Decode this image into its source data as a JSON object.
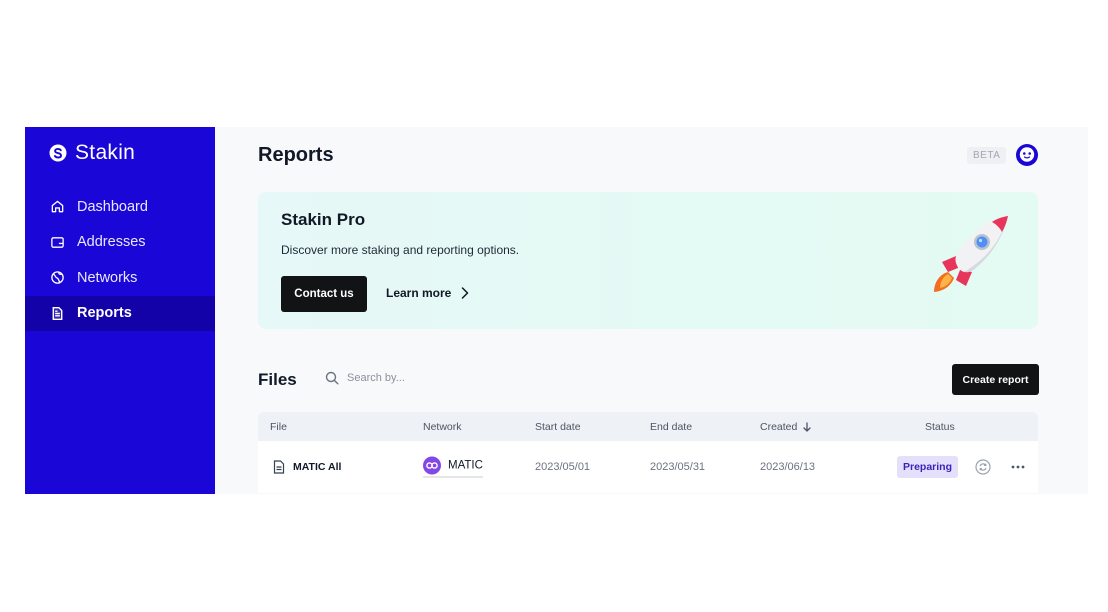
{
  "brand": {
    "name": "Stakin",
    "logo_icon": "stakin-logo-icon"
  },
  "sidebar": {
    "items": [
      {
        "label": "Dashboard",
        "icon": "home-icon",
        "active": false
      },
      {
        "label": "Addresses",
        "icon": "wallet-icon",
        "active": false
      },
      {
        "label": "Networks",
        "icon": "globe-icon",
        "active": false
      },
      {
        "label": "Reports",
        "icon": "document-icon",
        "active": true
      }
    ]
  },
  "header": {
    "title": "Reports",
    "beta_label": "BETA",
    "avatar_icon": "avatar-icon"
  },
  "promo": {
    "title": "Stakin Pro",
    "description": "Discover more staking and reporting options.",
    "contact_label": "Contact us",
    "learn_more_label": "Learn more",
    "illustration": "rocket-icon"
  },
  "files": {
    "title": "Files",
    "search_placeholder": "Search by...",
    "create_label": "Create report",
    "columns": {
      "file": "File",
      "network": "Network",
      "start_date": "Start date",
      "end_date": "End date",
      "created": "Created",
      "status": "Status"
    },
    "rows": [
      {
        "file": "MATIC All",
        "network": "MATIC",
        "start_date": "2023/05/01",
        "end_date": "2023/05/31",
        "created": "2023/06/13",
        "status": "Preparing"
      }
    ]
  },
  "colors": {
    "sidebar_bg": "#1a06d6",
    "sidebar_active": "#1202a8",
    "primary_button": "#111315",
    "status_badge_bg": "#e4e0fb",
    "status_badge_text": "#3a22b8",
    "matic": "#8247e5"
  }
}
